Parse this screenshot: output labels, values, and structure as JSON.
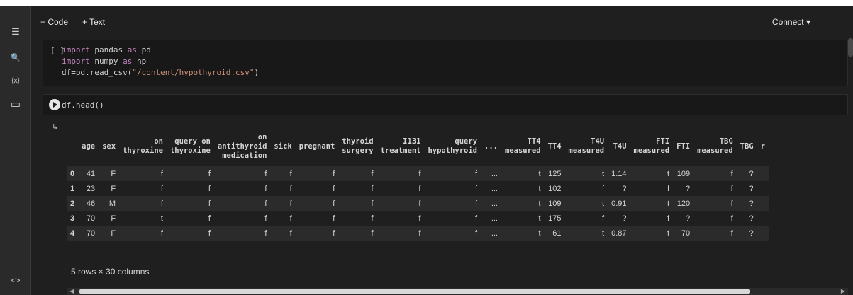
{
  "toolbar": {
    "code_label": "+ Code",
    "text_label": "+ Text",
    "connect_label": "Connect",
    "connect_caret": "▾",
    "collapse_glyph": "^"
  },
  "rail": {
    "toc_icon": "☰",
    "search_icon": "🔍",
    "variables_icon": "{x}",
    "files_icon": "▭",
    "code_snippets_icon": "<>"
  },
  "cell1": {
    "bracket": "[ ]",
    "lines": [
      {
        "kw": "import",
        "rest": " pandas ",
        "kw2": "as",
        "rest2": " pd"
      },
      {
        "kw": "import",
        "rest": " numpy ",
        "kw2": "as",
        "rest2": " np"
      }
    ],
    "line3_prefix": "df=pd.read_csv(",
    "line3_q1": "\"",
    "line3_link": "/content/hypothyroid.csv",
    "line3_q2": "\"",
    "line3_suffix": ")"
  },
  "cell2": {
    "code": "df.head()"
  },
  "output": {
    "icon": "↳",
    "columns": [
      "",
      "age",
      "sex",
      "on\nthyroxine",
      "query on\nthyroxine",
      "on\nantithyroid\nmedication",
      "sick",
      "pregnant",
      "thyroid\nsurgery",
      "I131\ntreatment",
      "query\nhypothyroid",
      "...",
      "TT4\nmeasured",
      "TT4",
      "T4U\nmeasured",
      "T4U",
      "FTI\nmeasured",
      "FTI",
      "TBG\nmeasured",
      "TBG",
      "r"
    ],
    "rows": [
      [
        "0",
        "41",
        "F",
        "f",
        "f",
        "f",
        "f",
        "f",
        "f",
        "f",
        "f",
        "...",
        "t",
        "125",
        "t",
        "1.14",
        "t",
        "109",
        "f",
        "?",
        ""
      ],
      [
        "1",
        "23",
        "F",
        "f",
        "f",
        "f",
        "f",
        "f",
        "f",
        "f",
        "f",
        "...",
        "t",
        "102",
        "f",
        "?",
        "f",
        "?",
        "f",
        "?",
        ""
      ],
      [
        "2",
        "46",
        "M",
        "f",
        "f",
        "f",
        "f",
        "f",
        "f",
        "f",
        "f",
        "...",
        "t",
        "109",
        "t",
        "0.91",
        "t",
        "120",
        "f",
        "?",
        ""
      ],
      [
        "3",
        "70",
        "F",
        "t",
        "f",
        "f",
        "f",
        "f",
        "f",
        "f",
        "f",
        "...",
        "t",
        "175",
        "f",
        "?",
        "f",
        "?",
        "f",
        "?",
        ""
      ],
      [
        "4",
        "70",
        "F",
        "f",
        "f",
        "f",
        "f",
        "f",
        "f",
        "f",
        "f",
        "...",
        "t",
        "61",
        "t",
        "0.87",
        "t",
        "70",
        "f",
        "?",
        ""
      ]
    ],
    "footer": "5 rows × 30 columns"
  }
}
